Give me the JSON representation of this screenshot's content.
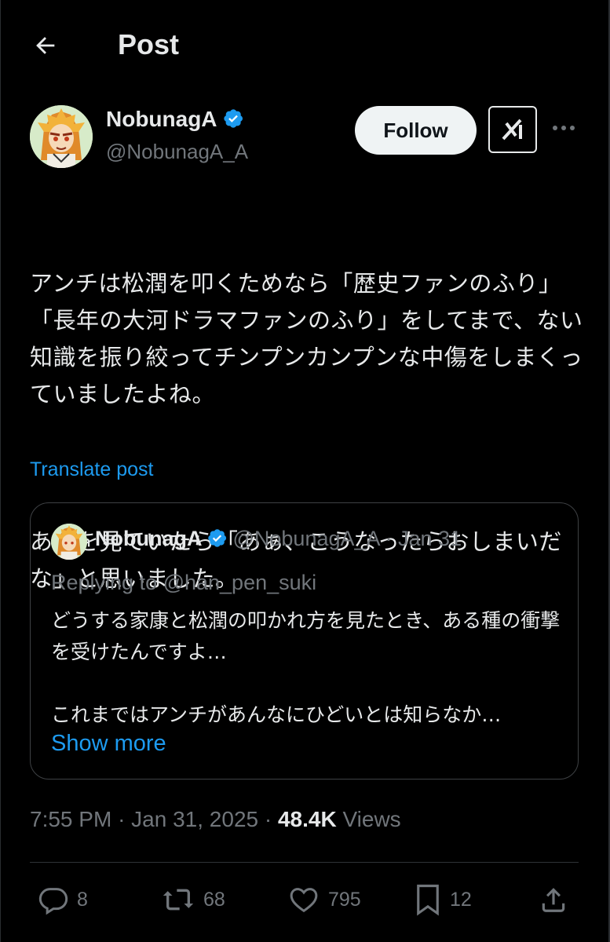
{
  "header": {
    "title": "Post",
    "back_icon": "arrow-left-icon"
  },
  "author": {
    "name": "NobunagA",
    "handle": "@NobunagA_A",
    "verified": true,
    "follow_label": "Follow",
    "grok_icon": "grok-icon",
    "more_icon": "more-horizontal-icon"
  },
  "post": {
    "paragraphs": [
      "アンチは松潤を叩くためなら「歴史ファンのふり」「長年の大河ドラマファンのふり」をしてまで、ない知識を振り絞ってチンプンカンプンな中傷をしまくっていましたよね。",
      "あれを見ていたら「あぁ、こうなったらおしまいだな」と思いました。"
    ],
    "translate_label": "Translate post"
  },
  "quote": {
    "name": "NobunagA",
    "handle": "@NobunagA_A",
    "date": "· Jan 31",
    "replying": "Replying to @han_pen_suki",
    "text": "どうする家康と松潤の叩かれ方を見たとき、ある種の衝撃を受けたんですよ…\n\nこれまではアンチがあんなにひどいとは知らなか…",
    "show_more": "Show more"
  },
  "meta": {
    "time": "7:55 PM",
    "date": "Jan 31, 2025",
    "views_count": "48.4K",
    "views_label": "Views"
  },
  "actions": {
    "replies": "8",
    "reposts": "68",
    "likes": "795",
    "bookmarks": "12"
  },
  "colors": {
    "accent": "#1d9bf0",
    "background": "#000000",
    "muted": "#71767b",
    "text": "#e7e9ea"
  }
}
